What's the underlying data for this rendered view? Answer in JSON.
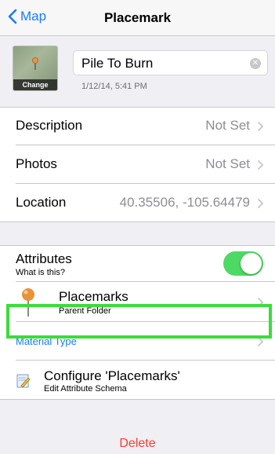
{
  "nav": {
    "back_label": "Map",
    "title": "Placemark"
  },
  "header": {
    "thumb_change_label": "Change",
    "name_value": "Pile To Burn",
    "timestamp": "1/12/14, 5:41 PM"
  },
  "details": [
    {
      "label": "Description",
      "value": "Not Set"
    },
    {
      "label": "Photos",
      "value": "Not Set"
    },
    {
      "label": "Location",
      "value": "40.35506, -105.64479"
    }
  ],
  "attributes": {
    "title": "Attributes",
    "help": "What is this?",
    "enabled": true,
    "folder_title": "Placemarks",
    "folder_subtitle": "Parent Folder",
    "material_type": "Material Type",
    "configure_title": "Configure 'Placemarks'",
    "configure_subtitle": "Edit Attribute Schema"
  },
  "delete_label": "Delete",
  "colors": {
    "accent": "#1a7cf9",
    "toggle_on": "#4cd964",
    "destructive": "#ff3b30",
    "highlight": "#3bdc3b"
  }
}
